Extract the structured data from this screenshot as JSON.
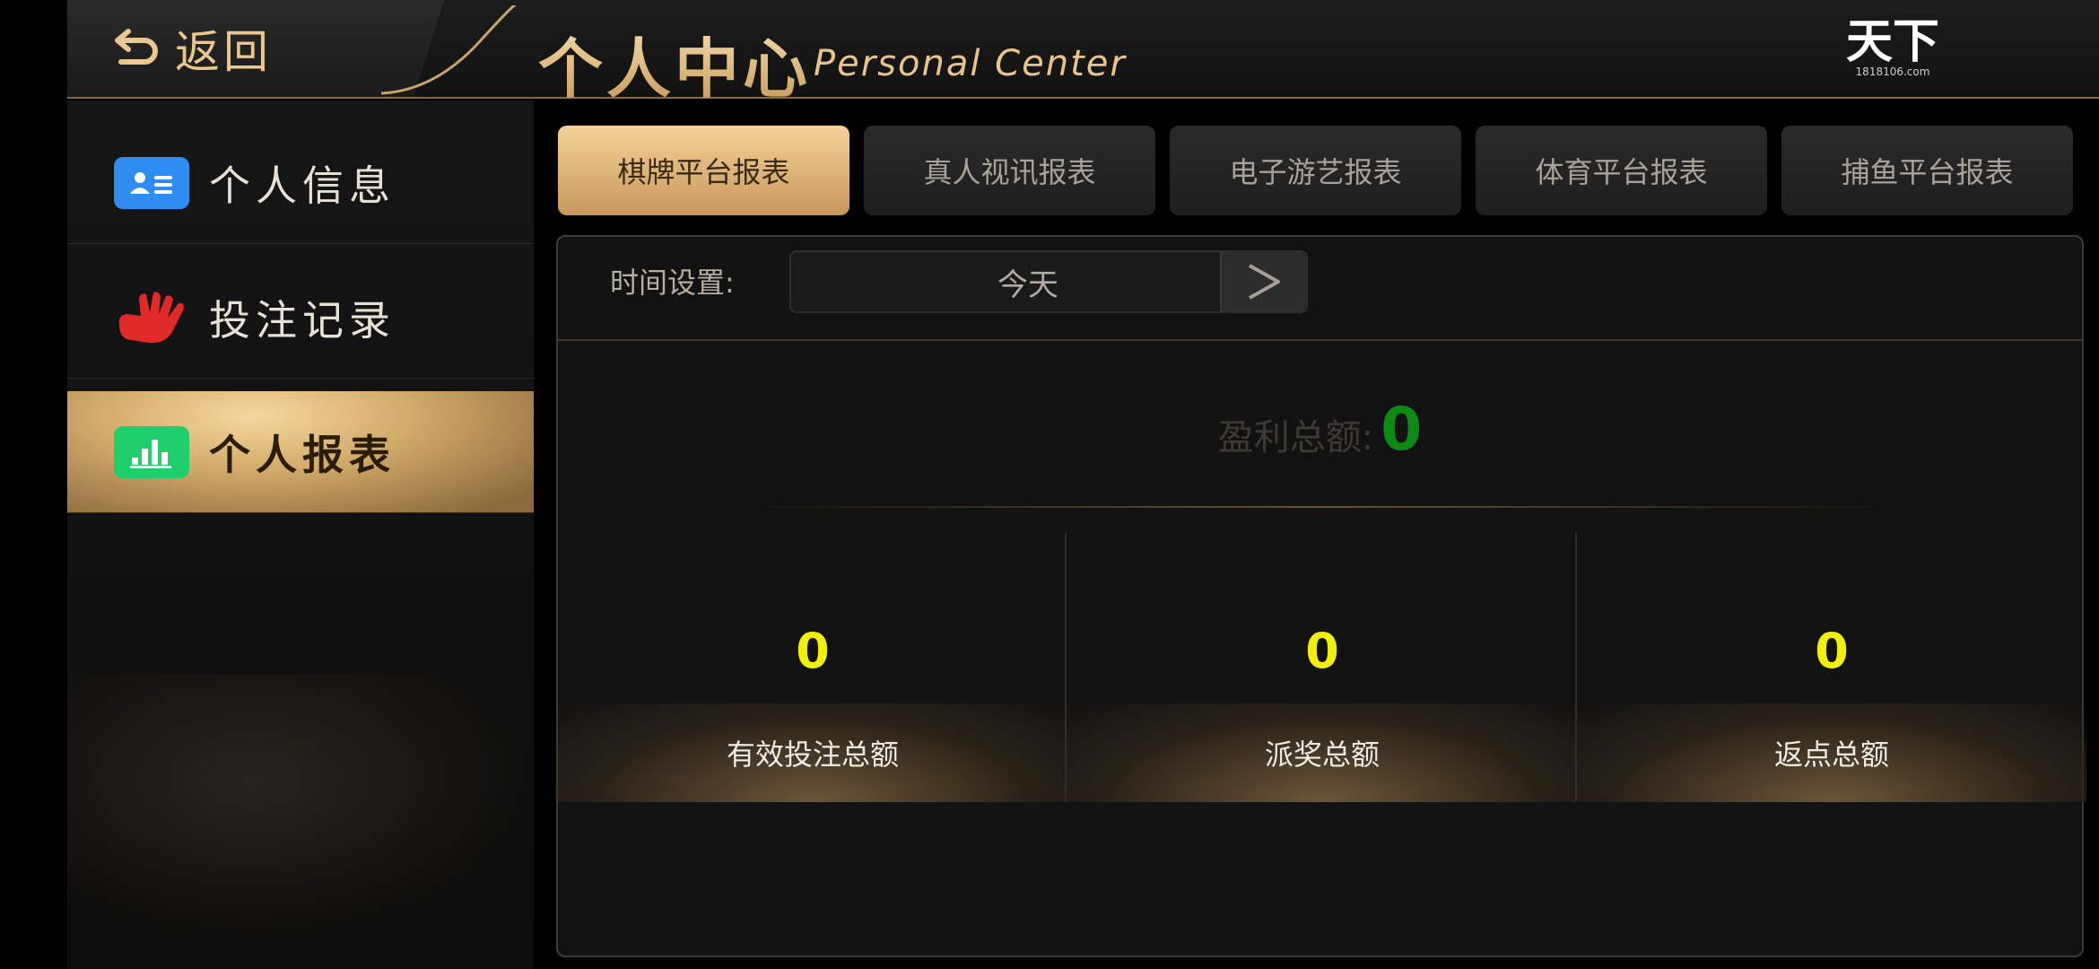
{
  "header": {
    "back_label": "返回",
    "title_cn": "个人中心",
    "title_en": "Personal Center",
    "logo_text": "天下",
    "logo_sub": "1818106.com"
  },
  "sidebar": {
    "items": [
      {
        "label": "个人信息",
        "icon": "id-card-icon",
        "active": false
      },
      {
        "label": "投注记录",
        "icon": "hand-icon",
        "active": false
      },
      {
        "label": "个人报表",
        "icon": "bar-chart-icon",
        "active": true
      }
    ]
  },
  "tabs": [
    {
      "label": "棋牌平台报表",
      "active": true
    },
    {
      "label": "真人视讯报表",
      "active": false
    },
    {
      "label": "电子游艺报表",
      "active": false
    },
    {
      "label": "体育平台报表",
      "active": false
    },
    {
      "label": "捕鱼平台报表",
      "active": false
    }
  ],
  "time": {
    "label": "时间设置:",
    "value": "今天"
  },
  "profit": {
    "label": "盈利总额:",
    "value": "0"
  },
  "stats": [
    {
      "value": "0",
      "label": "有效投注总额"
    },
    {
      "value": "0",
      "label": "派奖总额"
    },
    {
      "value": "0",
      "label": "返点总额"
    }
  ],
  "colors": {
    "accent_gold": "#e8c48a",
    "profit_green": "#0d8a16",
    "stat_yellow": "#f2ee0c"
  }
}
